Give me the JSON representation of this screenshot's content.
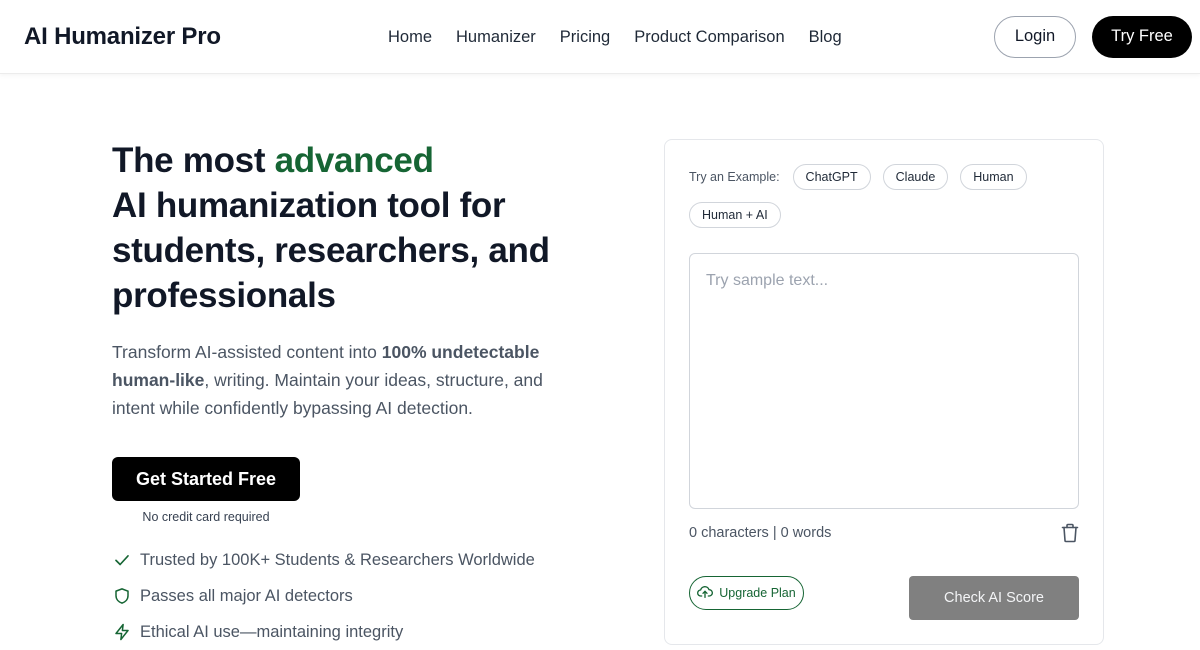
{
  "header": {
    "brand": "AI Humanizer Pro",
    "nav": [
      "Home",
      "Humanizer",
      "Pricing",
      "Product Comparison",
      "Blog"
    ],
    "login_label": "Login",
    "try_free_label": "Try Free"
  },
  "hero": {
    "title_prefix": "The most ",
    "title_accent": "advanced",
    "title_rest": "AI humanization tool for students, researchers, and professionals",
    "desc_part1": "Transform AI-assisted content into ",
    "desc_bold": "100% undetectable human-like",
    "desc_part2": ", writing. Maintain your ideas, structure, and intent while confidently bypassing AI detection.",
    "cta_label": "Get Started Free",
    "cta_note": "No credit card required",
    "features": [
      {
        "icon": "check-icon",
        "text": "Trusted by 100K+ Students & Researchers Worldwide"
      },
      {
        "icon": "shield-icon",
        "text": "Passes all major AI detectors"
      },
      {
        "icon": "lightning-icon",
        "text": "Ethical AI use—maintaining integrity"
      }
    ]
  },
  "panel": {
    "examples_label": "Try an Example:",
    "examples": [
      "ChatGPT",
      "Claude",
      "Human",
      "Human + AI"
    ],
    "input_placeholder": "Try sample text...",
    "input_value": "",
    "counts": "0 characters | 0 words",
    "upgrade_label": "Upgrade Plan",
    "check_label": "Check AI Score"
  },
  "colors": {
    "accent_green": "#166534",
    "primary_black": "#000000",
    "disabled_gray": "#808080"
  }
}
